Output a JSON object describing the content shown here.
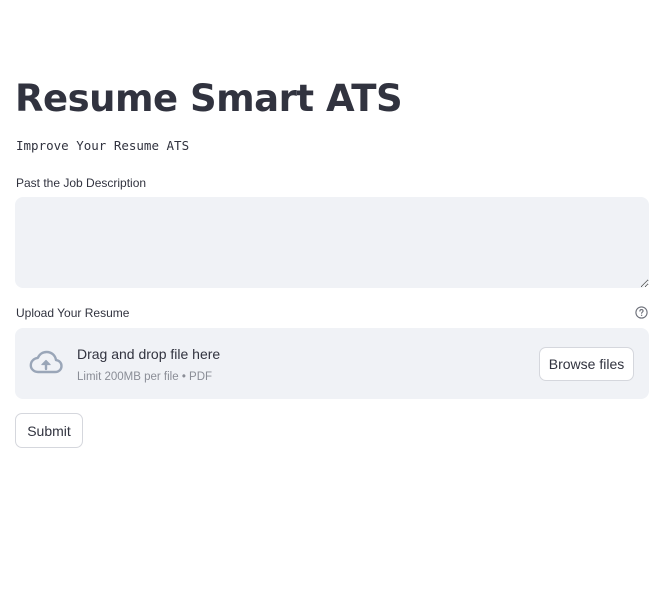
{
  "header": {
    "title": "Resume Smart ATS",
    "subtitle": "Improve Your Resume ATS"
  },
  "job_description": {
    "label": "Past the Job Description",
    "value": "",
    "placeholder": ""
  },
  "resume_upload": {
    "label": "Upload Your Resume",
    "help_icon": "question-circle-icon",
    "drop_text": "Drag and drop file here",
    "limit_text": "Limit 200MB per file • PDF",
    "browse_label": "Browse files",
    "upload_icon": "cloud-upload-icon"
  },
  "actions": {
    "submit_label": "Submit"
  },
  "colors": {
    "text": "#31333f",
    "input_bg": "#f0f2f6",
    "muted_text": "#8a8d96",
    "icon": "#9aa6b8",
    "button_border": "#d5d7dd"
  }
}
